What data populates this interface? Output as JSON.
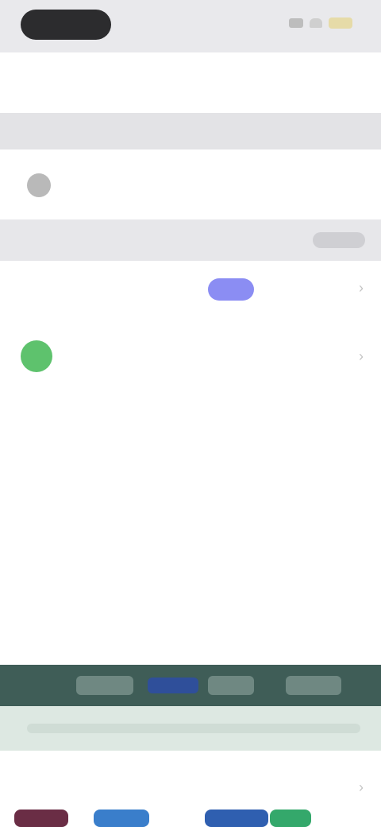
{
  "nav": {
    "left": "",
    "title": "",
    "right": ""
  },
  "account": {
    "text": ""
  },
  "list": {
    "primary": "",
    "switch_label": "",
    "subitems": [
      {
        "label": "",
        "right": ""
      },
      {
        "label": "",
        "right": ""
      },
      {
        "label": "",
        "right": ""
      },
      {
        "label": "",
        "right": ""
      },
      {
        "label": "",
        "right": ""
      },
      {
        "label": "",
        "right": ""
      },
      {
        "label": "",
        "right": ""
      }
    ]
  },
  "banner": {
    "text": ""
  },
  "bottom": {
    "title": ""
  }
}
